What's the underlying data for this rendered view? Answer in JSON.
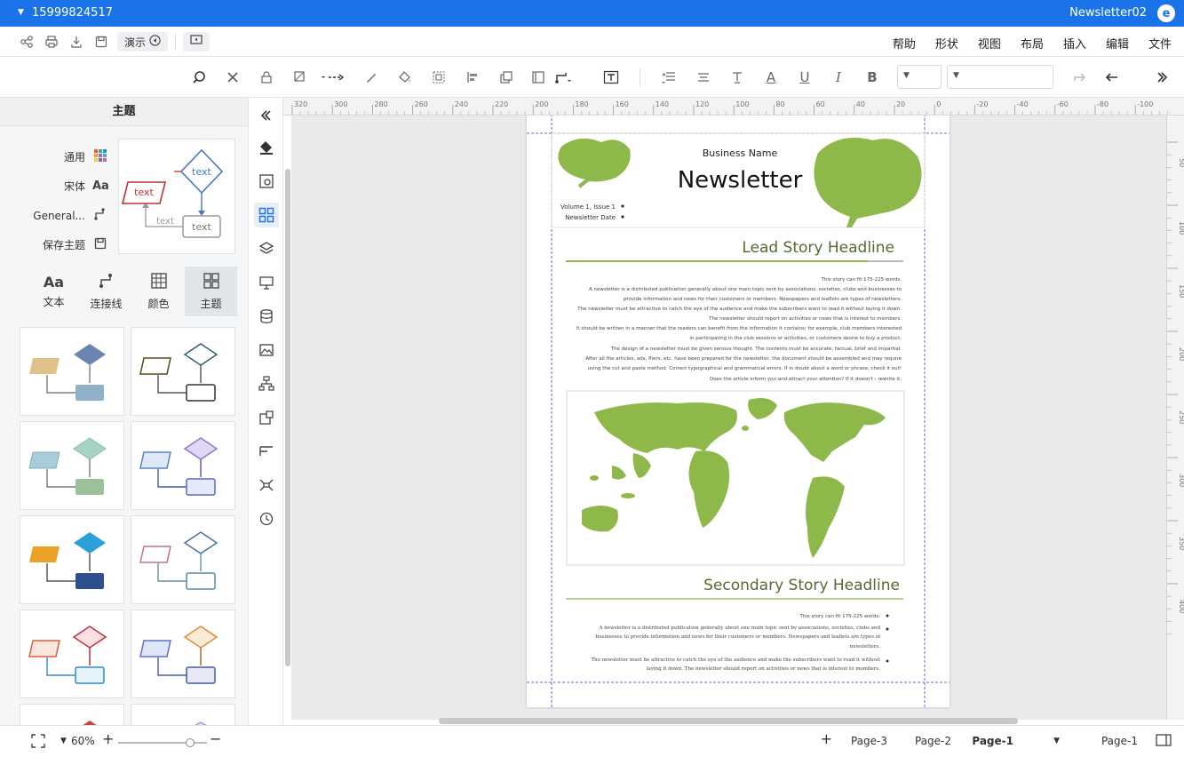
{
  "titlebar": {
    "doc_title": "Newsletter02",
    "account": "15999824517",
    "app_icon": "edraw-logo"
  },
  "menu": {
    "items": [
      "文件",
      "编辑",
      "插入",
      "布局",
      "视图",
      "形状",
      "帮助"
    ],
    "present_label": "演示"
  },
  "left_panel": {
    "title": "主题",
    "themes": [
      {
        "label": "通用",
        "icon": "grid-color-icon"
      },
      {
        "label": "宋体",
        "icon": "font-icon"
      },
      {
        "label": "General...",
        "icon": "connector-icon"
      },
      {
        "label": "保存主题",
        "icon": "save-icon"
      }
    ],
    "tabs": [
      {
        "label": "主题",
        "icon": "theme-grid-icon"
      },
      {
        "label": "颜色",
        "icon": "color-icon"
      },
      {
        "label": "连接线",
        "icon": "connector-icon"
      },
      {
        "label": "文本",
        "icon": "text-icon"
      }
    ],
    "preview_labels": [
      "text",
      "text",
      "text",
      "text"
    ]
  },
  "ruler": {
    "h_ticks": [
      "320",
      "300",
      "280",
      "260",
      "240",
      "220",
      "200",
      "180",
      "160",
      "140",
      "120",
      "100",
      "80",
      "60",
      "40",
      "20",
      "0",
      "-20",
      "-40",
      "-60",
      "-80",
      "-100"
    ],
    "v_ticks": [
      "50",
      "100",
      "150",
      "200",
      "250",
      "300",
      "350",
      "400"
    ]
  },
  "document": {
    "business_name": "Business Name",
    "newsletter": "Newsletter",
    "bullets": [
      "Volume 1, Issue 1",
      "Newsletter Date"
    ],
    "lead_headline": "Lead Story Headline",
    "lead_body": [
      "This story can fit 175-225 words.",
      "A newsletter is a distributed publication generally about one main topic sent by associations, societies, clubs and businesses to",
      "provide information and news for their customers or members. Newspapers and leaflets are types of newsletters.",
      "The newsletter must be attractive to catch the eye of the audience and make the subscribers want to read it without laying it down.",
      "The newsletter should report on activities or news that is interest to members.",
      "It should be written in a manner that the readers can benefit from the information it contains; for example, club members interested",
      "in participating in the club sessions or activities, or customers desire to buy a product.",
      "The design of a newsletter must be given serious thought. The contents must be accurate, factual, brief and impartial.",
      "After all the articles, ads, fliers, etc. have been prepared for the newsletter, the document should be assembled and may require",
      "using the cut and paste method. Correct typographical and grammatical errors. If in doubt about a word or phrase, check it out!",
      "Does the article inform you and attract your attention? If it doesn't - rewrite it."
    ],
    "secondary_headline": "Secondary Story Headline",
    "secondary_bullets": [
      "This story can fit 175-225 words.",
      "A newsletter is a distributed publication generally about one main topic sent by associations, societies, clubs and businesses to provide information and news for their customers or members. Newspapers and leaflets are types of newsletters.",
      "The newsletter must be attractive to catch the eye of the audience and make the subscribers want to read it without laying it down. The newsletter should report on activities or news that is interest to members."
    ],
    "accent_color": "#8fb84a"
  },
  "status": {
    "zoom": "60%",
    "pages": [
      "Page-1",
      "Page-2",
      "Page-3"
    ],
    "current_page": "Page-1",
    "page_select": "Page-1"
  }
}
